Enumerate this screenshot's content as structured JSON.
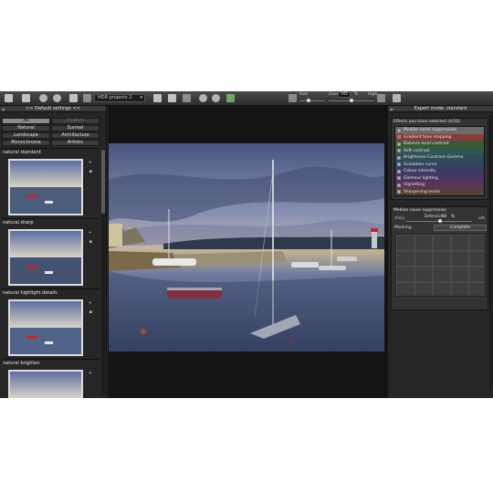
{
  "toolbar": {
    "preset_select": "HDR projects 2",
    "size_label": "Size",
    "zoom_label": "Zoom",
    "zoom_value": "101",
    "zoom_unit": "%",
    "high_label": "High",
    "icons": [
      "new-icon",
      "open-icon",
      "compare-icon",
      "globe-icon",
      "save-icon",
      "crop-icon",
      "export-icon",
      "print-icon",
      "settings-icon",
      "info-icon",
      "help-icon",
      "logo-icon",
      "split-view-icon",
      "fullscreen-icon",
      "zoom-out-icon",
      "zoom-in-icon",
      "undo-icon"
    ]
  },
  "left_panel": {
    "header": ">> Default settings <<",
    "categories": [
      "All",
      "Custom",
      "Natural",
      "Surreal",
      "Landscape",
      "Architecture",
      "Monochrome",
      "Artistic"
    ],
    "presets": [
      {
        "name": "natural standard"
      },
      {
        "name": "natural sharp"
      },
      {
        "name": "natural highlight details"
      },
      {
        "name": "natural brighten"
      }
    ],
    "add_icon": "plus-icon",
    "delete_icon": "trash-icon"
  },
  "right_panel": {
    "header": "Expert mode: standard",
    "effects_title": "Effects you have selected (4/10)",
    "effects": [
      {
        "label": "Median noise suppression",
        "checked": false,
        "color": "#6b6b6b"
      },
      {
        "label": "Gradient tone mapping",
        "checked": true,
        "color": "#8a3a3a"
      },
      {
        "label": "Balance local contrast",
        "checked": false,
        "color": "#3a5a36"
      },
      {
        "label": "Soft contrast",
        "checked": false,
        "color": "#2f5650"
      },
      {
        "label": "Brightness–Contrast–Gamma",
        "checked": false,
        "color": "#2d4d5a"
      },
      {
        "label": "Gradation curve",
        "checked": false,
        "color": "#30445e"
      },
      {
        "label": "Colour intensity",
        "checked": false,
        "color": "#3a3a62"
      },
      {
        "label": "Glamour lighting",
        "checked": false,
        "color": "#4a3760"
      },
      {
        "label": "Vignetting",
        "checked": false,
        "color": "#5a3556"
      },
      {
        "label": "Sharpening levels",
        "checked": false,
        "color": "#53402f"
      }
    ],
    "median_title": "Median noise suppression",
    "sharp_label": "sharp",
    "soft_label": "soft",
    "defensive_label": "Defensive",
    "defensive_value": "50",
    "defensive_unit": "%",
    "masking_label": "Masking",
    "masking_value": "Complete"
  }
}
